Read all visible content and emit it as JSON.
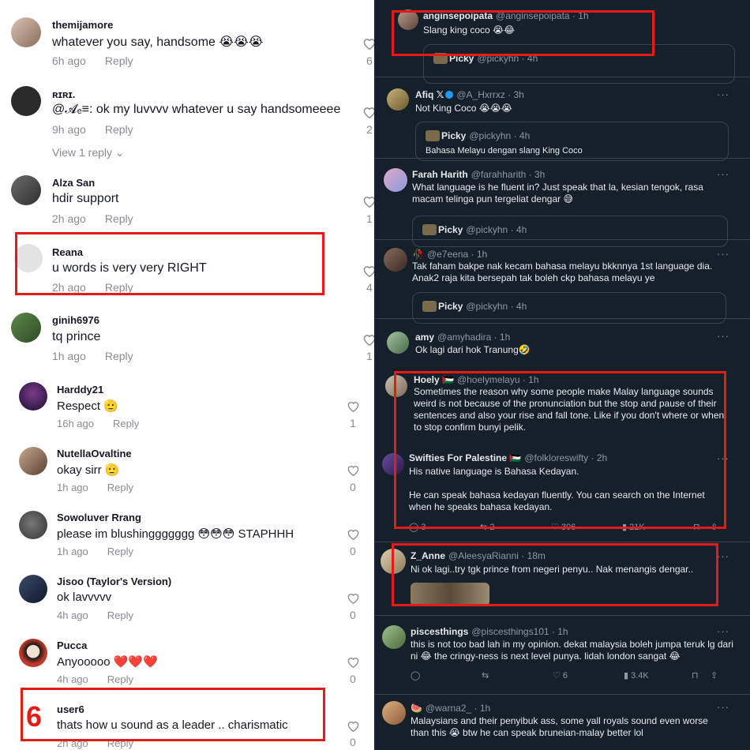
{
  "left_comments": [
    {
      "user": "themijamore",
      "text": "whatever you say, handsome 😭😭😭",
      "time": "6h ago",
      "reply": "Reply",
      "likes": "6"
    },
    {
      "user": "ʀɪʀɪ.",
      "text": "@𝓐ₑ≡: ok my luvvvv whatever u say handsomeeee",
      "time": "9h ago",
      "reply": "Reply",
      "likes": "2",
      "view_replies": "View 1 reply"
    },
    {
      "user": "Alza San",
      "text": "hdir support",
      "time": "2h ago",
      "reply": "Reply",
      "likes": "1"
    },
    {
      "user": "Reana",
      "text": "u words is very very RIGHT",
      "time": "2h ago",
      "reply": "Reply",
      "likes": "4"
    },
    {
      "user": "ginih6976",
      "text": "tq prince",
      "time": "1h ago",
      "reply": "Reply",
      "likes": "1"
    },
    {
      "user": "Harddy21",
      "text": "Respect 🫡",
      "time": "16h ago",
      "reply": "Reply",
      "likes": "1"
    },
    {
      "user": "NutellaOvaltine",
      "text": "okay sirr 🫡",
      "time": "1h ago",
      "reply": "Reply",
      "likes": "0"
    },
    {
      "user": "Sowoluver Rrang",
      "text": "please im blushinggggggg 😳😳😳 STAPHHH",
      "time": "1h ago",
      "reply": "Reply",
      "likes": "0"
    },
    {
      "user": "Jisoo (Taylor's Version)",
      "text": "ok lavvvvv",
      "time": "4h ago",
      "reply": "Reply",
      "likes": "0"
    },
    {
      "user": "Pucca",
      "text": "Anyooooo ❤️❤️❤️",
      "time": "4h ago",
      "reply": "Reply",
      "likes": "0"
    },
    {
      "user": "user6",
      "text": "thats how u sound as a leader .. charismatic",
      "time": "2h ago",
      "reply": "Reply",
      "likes": "0"
    }
  ],
  "annotation_number": "6",
  "tweets": [
    {
      "name": "anginsepoipata",
      "handle": "@anginsepoipata · 1h",
      "text": "Slang king coco 😭😂",
      "quote_name": "Picky",
      "quote_handle": "@pickyhn · 4h"
    },
    {
      "name": "Afiq 𝕏",
      "handle": "@A_Hxrrxz · 3h",
      "text": "Not King Coco 😭😭😭",
      "quote_name": "Picky",
      "quote_handle": "@pickyhn · 4h",
      "quote_text": "Bahasa Melayu dengan slang King Coco"
    },
    {
      "name": "Farah Harith",
      "handle": "@farahharith · 3h",
      "text": "What language is he fluent in? Just speak that la, kesian tengok, rasa macam telinga pun tergeliat dengar 😅",
      "quote_name": "Picky",
      "quote_handle": "@pickyhn · 4h"
    },
    {
      "name": "🥀",
      "handle": "@e7eena · 1h",
      "text": "Tak faham bakpe nak kecam bahasa melayu bkknnya 1st language dia. Anak2 raja kita bersepah tak boleh ckp bahasa melayu ye",
      "quote_name": "Picky",
      "quote_handle": "@pickyhn · 4h"
    },
    {
      "name": "amy",
      "handle": "@amyhadira · 1h",
      "text": "Ok lagi dari hok Tranung🤣"
    },
    {
      "name": "Hoely 🇵🇸",
      "handle": "@hoelymelayu · 1h",
      "text": "Sometimes the reason why some people make Malay language sounds weird is not because of the pronunciation but the stop and pause of their sentences and also your rise and fall tone. Like if you don't where or when to stop confirm bunyi pelik."
    },
    {
      "name": "Swifties For Palestine 🇵🇸",
      "handle": "@folkloreswifty · 2h",
      "text": "His native language is Bahasa Kedayan.",
      "text2": "He can speak bahasa kedayan fluently. You can search on the Internet when he speaks bahasa kedayan.",
      "actions": {
        "reply": "3",
        "retweet": "2",
        "like": "306",
        "views": "21K"
      }
    },
    {
      "name": "Z_Anne",
      "handle": "@AleesyaRianni · 18m",
      "text": "Ni ok lagi..try tgk prince from negeri penyu.. Nak menangis dengar.."
    },
    {
      "name": "piscesthings",
      "handle": "@piscesthings101 · 1h",
      "text": "this is not too bad lah in my opinion. dekat malaysia boleh jumpa teruk lg dari ni 😂 the cringy-ness is next level punya. lidah london sangat 😂",
      "actions": {
        "reply": "",
        "retweet": "",
        "like": "6",
        "views": "3.4K"
      }
    },
    {
      "name": "🍉",
      "handle": "@warna2_ · 1h",
      "text": "Malaysians and their penyibuk ass, some yall royals sound even worse than this 😭 btw he can speak bruneian-malay better lol"
    }
  ],
  "colors": {
    "highlight": "#e41b17",
    "dark_bg": "#15202b",
    "link": "#1d9bf0"
  }
}
